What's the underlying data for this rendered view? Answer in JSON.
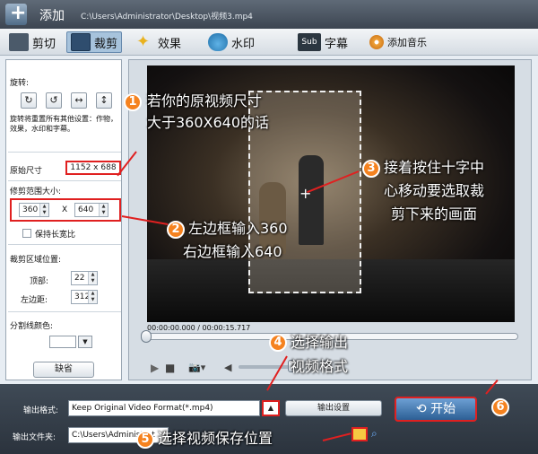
{
  "window": {
    "title": "添加",
    "path": "C:\\Users\\Administrator\\Desktop\\视频3.mp4"
  },
  "tabs": [
    {
      "label": "剪切",
      "icon": "film-cut-icon"
    },
    {
      "label": "裁剪",
      "icon": "crop-icon"
    },
    {
      "label": "效果",
      "icon": "effects-star-icon"
    },
    {
      "label": "水印",
      "icon": "watermark-drop-icon"
    },
    {
      "label": "字幕",
      "icon": "subtitle-sub-icon"
    },
    {
      "label": "添加音乐",
      "icon": "music-disc-icon"
    }
  ],
  "panel": {
    "rotate_label": "旋转:",
    "rotate_note": "旋转将重置所有其他设置：作物，效果，水印和字幕。",
    "original_size_label": "原始尺寸",
    "original_size_value": "1152 x 688",
    "crop_size_label": "修剪范围大小:",
    "width": "360",
    "height": "640",
    "x_sep": "X",
    "keep_ratio": "保持长宽比",
    "crop_pos_label": "裁剪区域位置:",
    "top_label": "顶部:",
    "top_value": "22",
    "left_label": "左边距:",
    "left_value": "312",
    "line_color_label": "分割线颜色:",
    "default_button": "缺省"
  },
  "player": {
    "timecode": "00:00:00.000 / 00:00:15.717"
  },
  "bottom": {
    "format_label": "输出格式:",
    "format_value": "Keep Original Video Format(*.mp4)",
    "output_settings": "输出设置",
    "folder_label": "输出文件夹:",
    "folder_value": "C:\\Users\\Administrat",
    "start": "开始"
  },
  "annotations": {
    "n1": "1",
    "a1_line1": "若你的原视频尺寸",
    "a1_line2": "大于360X640的话",
    "n2": "2",
    "a2_line1": "左边框输入360",
    "a2_line2": "右边框输入640",
    "n3": "3",
    "a3_line1": "接着按住十字中",
    "a3_line2": "心移动要选取裁",
    "a3_line3": "剪下来的画面",
    "n4": "4",
    "a4_line1": "选择输出",
    "a4_line2": "视频格式",
    "n5": "5",
    "a5_line1": "选择视频保存位置",
    "n6": "6"
  },
  "colors": {
    "accent_red": "#e02020",
    "number_badge": "#f5821f"
  }
}
